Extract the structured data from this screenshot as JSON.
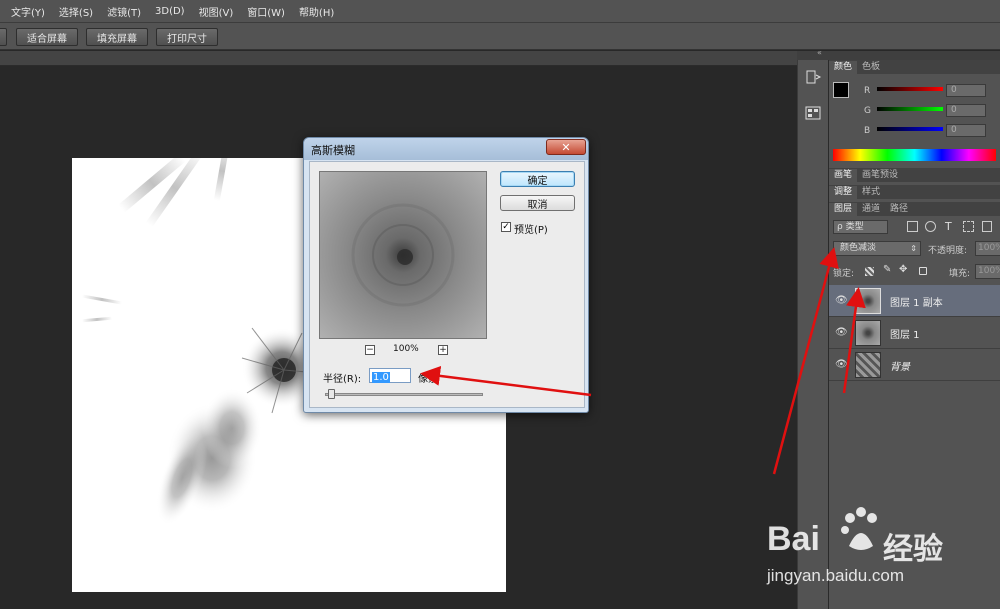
{
  "menubar": {
    "items": [
      "文字(Y)",
      "选择(S)",
      "滤镜(T)",
      "3D(D)",
      "视图(V)",
      "窗口(W)",
      "帮助(H)"
    ]
  },
  "options_bar": {
    "fit_screen": "适合屏幕",
    "fill_screen": "填充屏幕",
    "print_size": "打印尺寸"
  },
  "dialog": {
    "title": "高斯模糊",
    "close_glyph": "✕",
    "ok_label": "确定",
    "cancel_label": "取消",
    "preview_label": "预览(P)",
    "preview_checked": true,
    "zoom_level": "100%",
    "zoom_out_glyph": "−",
    "zoom_in_glyph": "+",
    "radius_label": "半径(R):",
    "radius_value": "1.0",
    "radius_unit": "像素"
  },
  "color_panel": {
    "tabs": [
      "颜色",
      "色板"
    ],
    "channels": [
      {
        "label": "R",
        "value": "0",
        "color": "#ff0000"
      },
      {
        "label": "G",
        "value": "0",
        "color": "#00ff00"
      },
      {
        "label": "B",
        "value": "0",
        "color": "#0000ff"
      }
    ]
  },
  "brush_tabs": [
    "画笔",
    "画笔预设"
  ],
  "adjust_tabs": [
    "调整",
    "样式"
  ],
  "layers_panel": {
    "tabs": [
      "图层",
      "通道",
      "路径"
    ],
    "filter_kind": "ρ 类型",
    "blend_mode": "颜色减淡",
    "opacity_label": "不透明度:",
    "opacity_value": "100%",
    "lock_label": "锁定:",
    "fill_label": "填充:",
    "fill_value": "100%",
    "layers": [
      {
        "name": "图层 1 副本",
        "selected": true
      },
      {
        "name": "图层 1",
        "selected": false
      },
      {
        "name": "背景",
        "selected": false
      }
    ]
  },
  "watermark": {
    "brand_left": "Bai",
    "brand_right": "经验",
    "url": "jingyan.baidu.com"
  },
  "annotation_color": "#e01010"
}
